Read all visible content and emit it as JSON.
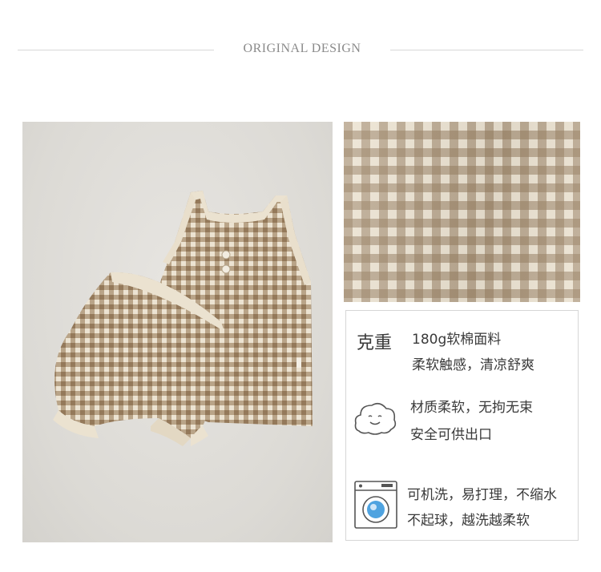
{
  "header": {
    "title": "ORIGINAL DESIGN"
  },
  "info": {
    "weight_label": "克重",
    "fabric_line1": "180g软棉面料",
    "fabric_line2": "柔软触感，清凉舒爽",
    "soft_line1": "材质柔软，无拘无束",
    "soft_line2": "安全可供出口",
    "wash_line1": "可机洗，易打理，不缩水",
    "wash_line2": "不起球，越洗越柔软"
  },
  "icons": {
    "soft": "cloud-smile-icon",
    "wash": "washing-machine-icon"
  },
  "colors": {
    "check_brown": "#967d5f",
    "check_cream": "#ece3d2",
    "text": "#3a3a3a"
  }
}
